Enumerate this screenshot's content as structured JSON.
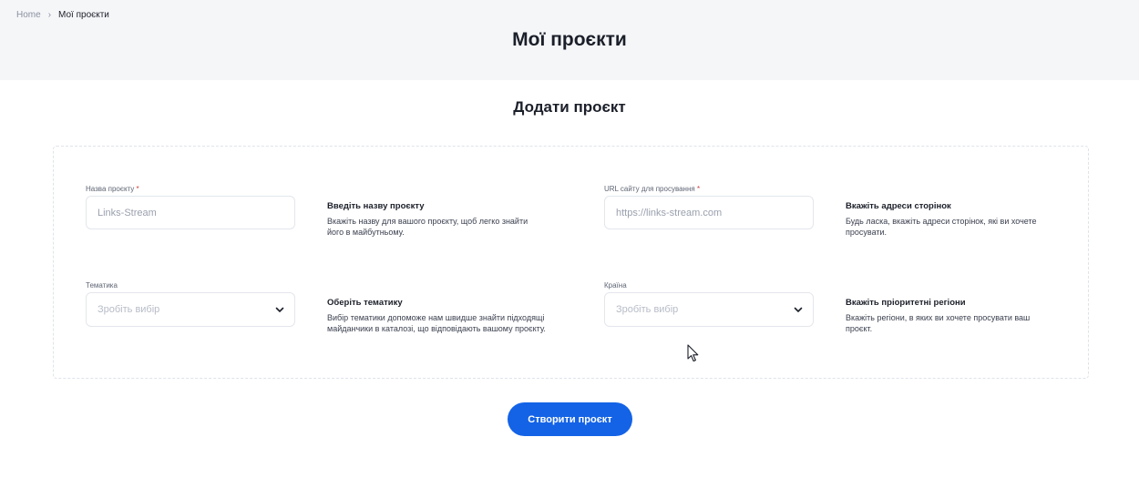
{
  "breadcrumb": {
    "home": "Home",
    "current": "Мої проєкти"
  },
  "page_title": "Мої проєкти",
  "section_title": "Додати проєкт",
  "form": {
    "project_name": {
      "label": "Назва проєкту",
      "required_mark": "*",
      "placeholder": "Links-Stream",
      "hint_title": "Введіть назву проєкту",
      "hint_text": "Вкажіть назву для вашого проєкту, щоб легко знайти його в майбутньому."
    },
    "url": {
      "label": "URL сайту для просування",
      "required_mark": "*",
      "placeholder": "https://links-stream.com",
      "hint_title": "Вкажіть адреси сторінок",
      "hint_text": "Будь ласка, вкажіть адреси сторінок, які ви хочете просувати."
    },
    "topic": {
      "label": "Тематика",
      "value": "Зробіть вибір",
      "hint_title": "Оберіть тематику",
      "hint_text": "Вибір тематики допоможе нам швидше знайти підходящі майданчики в каталозі, що відповідають вашому проєкту."
    },
    "country": {
      "label": "Країна",
      "value": "Зробіть вибір",
      "hint_title": "Вкажіть пріоритетні регіони",
      "hint_text": "Вкажіть регіони, в яких ви хочете просувати ваш проєкт."
    }
  },
  "submit_label": "Створити проєкт",
  "colors": {
    "accent": "#1463e6",
    "required": "#d13b3b"
  },
  "icons": {
    "breadcrumb_sep": "chevron-right-icon",
    "select": "chevron-down-icon"
  }
}
